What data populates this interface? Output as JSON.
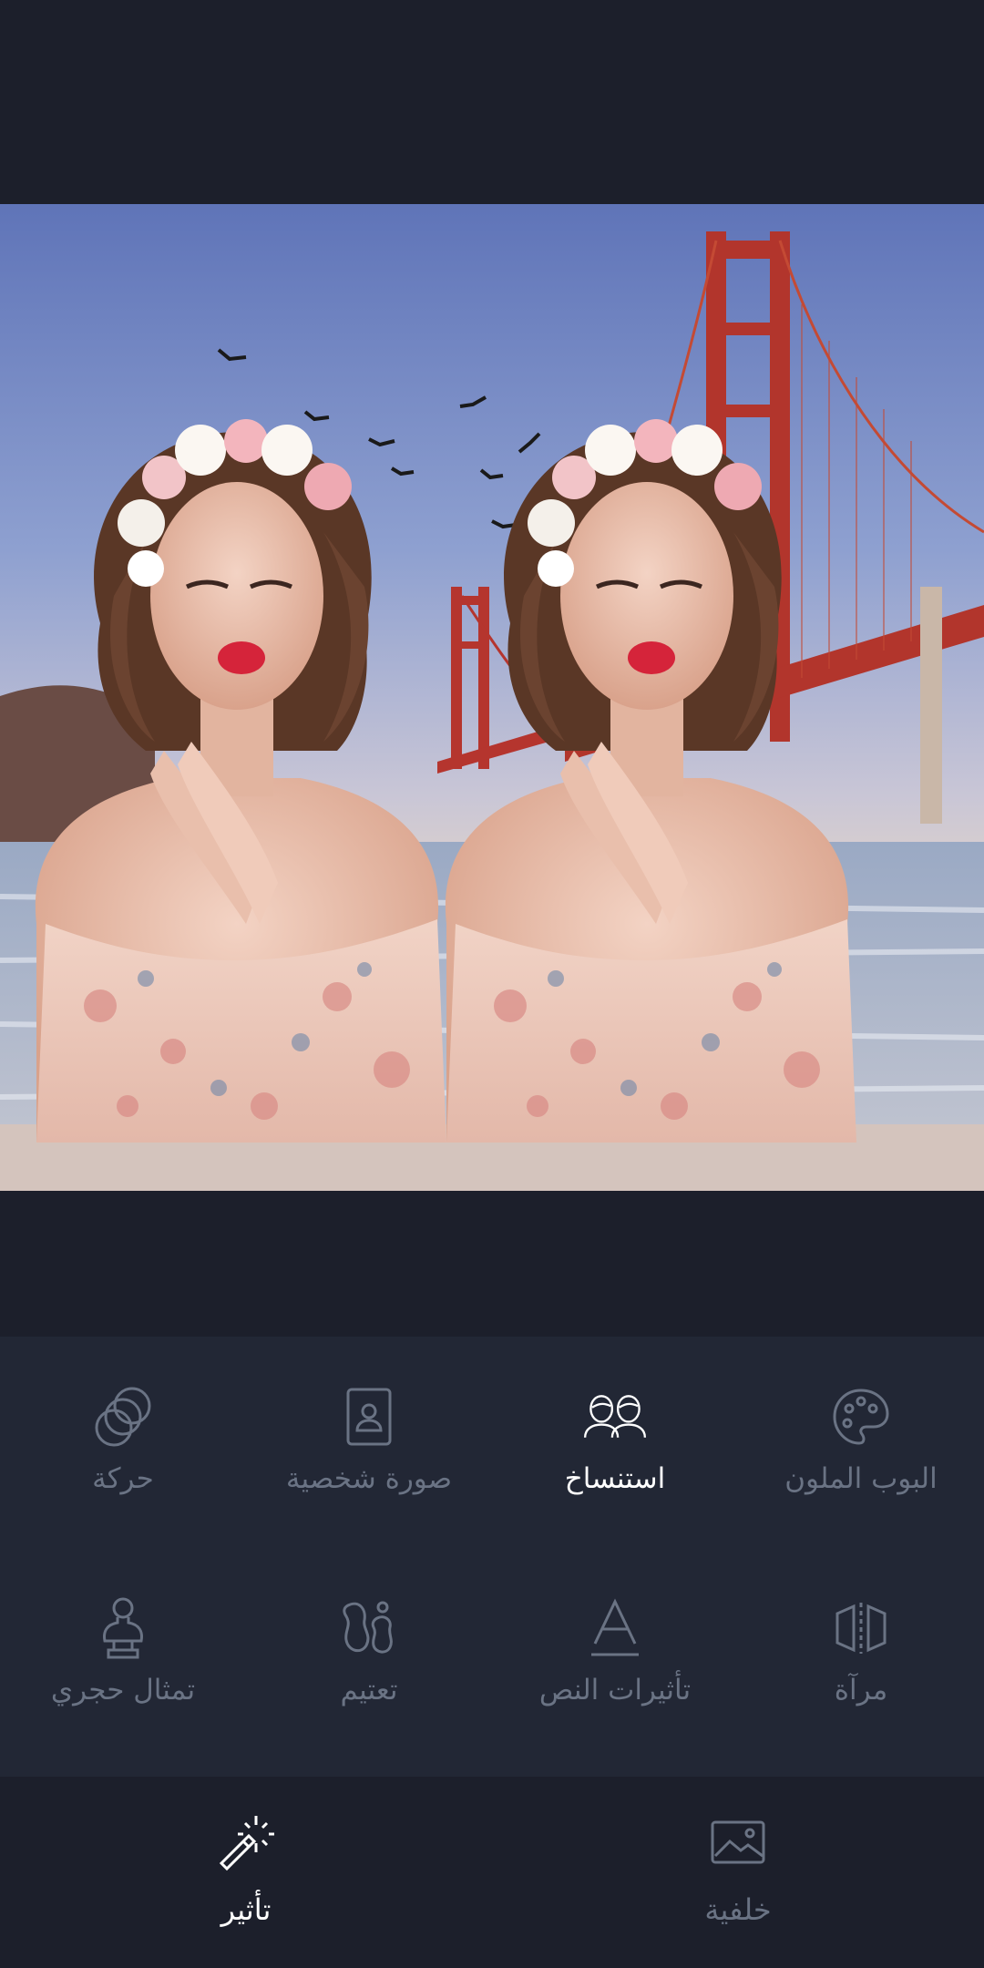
{
  "tools": {
    "row1": [
      {
        "label": "البوب الملون",
        "icon": "palette-icon",
        "active": false
      },
      {
        "label": "استنساخ",
        "icon": "clone-people-icon",
        "active": true
      },
      {
        "label": "صورة شخصية",
        "icon": "portrait-icon",
        "active": false
      },
      {
        "label": "حركة",
        "icon": "motion-circles-icon",
        "active": false
      }
    ],
    "row2": [
      {
        "label": "مرآة",
        "icon": "mirror-icon",
        "active": false
      },
      {
        "label": "تأثيرات النص",
        "icon": "text-effects-icon",
        "active": false
      },
      {
        "label": "تعتيم",
        "icon": "blur-shapes-icon",
        "active": false
      },
      {
        "label": "تمثال حجري",
        "icon": "bust-statue-icon",
        "active": false
      }
    ]
  },
  "nav": {
    "background_label": "خلفية",
    "effect_label": "تأثير",
    "active": "effect"
  },
  "colors": {
    "app_background": "#1c1f2b",
    "panel_background": "#222735",
    "inactive_text": "#6a7384",
    "active_text": "#ffffff"
  }
}
